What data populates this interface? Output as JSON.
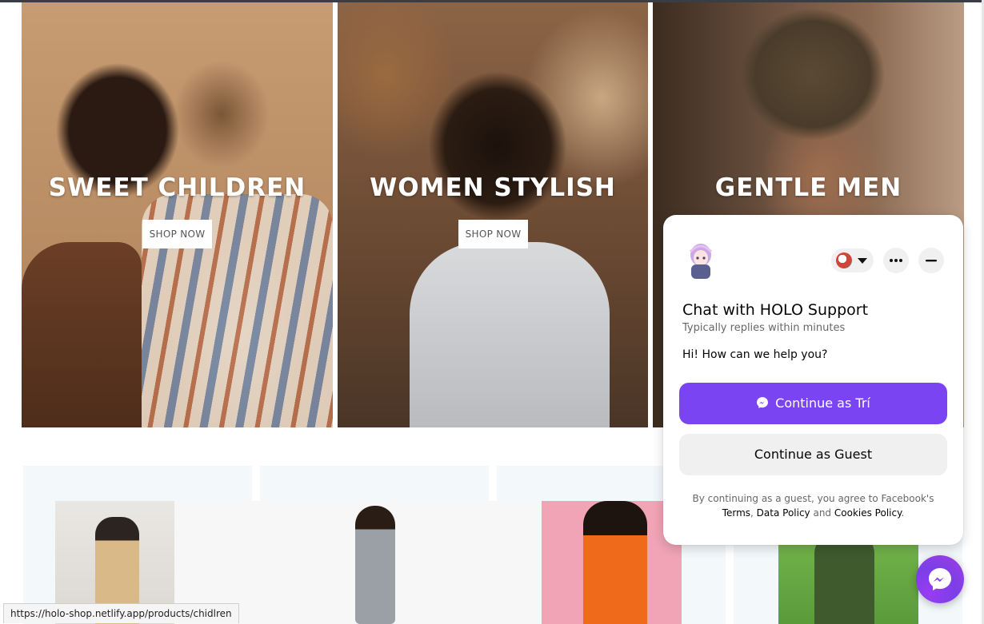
{
  "banners": [
    {
      "title": "SWEET CHILDREN",
      "button": "SHOP NOW"
    },
    {
      "title": "WOMEN STYLISH",
      "button": "SHOP NOW"
    },
    {
      "title": "GENTLE MEN"
    }
  ],
  "status_bar": {
    "url": "https://holo-shop.netlify.app/products/chidlren"
  },
  "chat": {
    "title": "Chat with HOLO Support",
    "subtitle": "Typically replies within minutes",
    "greeting": "Hi! How can we help you?",
    "continue_user": "Continue as Trí",
    "continue_guest": "Continue as Guest",
    "legal_prefix": "By continuing as a guest, you agree to Facebook's",
    "terms": "Terms",
    "sep1": ", ",
    "data_policy": "Data Policy",
    "and": " and ",
    "cookies_policy": "Cookies Policy",
    "period": ".",
    "accent_color": "#7b44f3"
  },
  "icons": [
    "messenger-icon",
    "more-icon",
    "minimize-icon",
    "caret-down-icon",
    "bot-avatar-icon"
  ]
}
